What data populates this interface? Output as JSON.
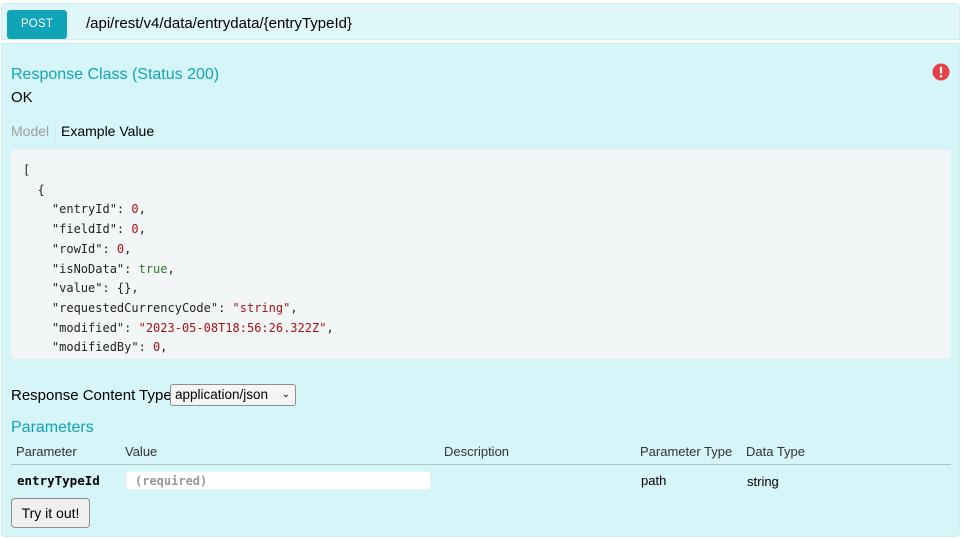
{
  "operation": {
    "method": "POST",
    "path": "/api/rest/v4/data/entrydata/{entryTypeId}"
  },
  "response_class": {
    "title": "Response Class (Status 200)",
    "status_text": "OK",
    "warning_icon": "error-circle-icon",
    "tabs": {
      "model": "Model",
      "example": "Example Value"
    },
    "example_lines": [
      [
        {
          "t": "[",
          "c": "p"
        }
      ],
      [
        {
          "t": "  {",
          "c": "p"
        }
      ],
      [
        {
          "t": "    \"entryId\": ",
          "c": "k"
        },
        {
          "t": "0",
          "c": "n"
        },
        {
          "t": ",",
          "c": "p"
        }
      ],
      [
        {
          "t": "    \"fieldId\": ",
          "c": "k"
        },
        {
          "t": "0",
          "c": "n"
        },
        {
          "t": ",",
          "c": "p"
        }
      ],
      [
        {
          "t": "    \"rowId\": ",
          "c": "k"
        },
        {
          "t": "0",
          "c": "n"
        },
        {
          "t": ",",
          "c": "p"
        }
      ],
      [
        {
          "t": "    \"isNoData\": ",
          "c": "k"
        },
        {
          "t": "true",
          "c": "b"
        },
        {
          "t": ",",
          "c": "p"
        }
      ],
      [
        {
          "t": "    \"value\": {},",
          "c": "k"
        }
      ],
      [
        {
          "t": "    \"requestedCurrencyCode\": ",
          "c": "k"
        },
        {
          "t": "\"string\"",
          "c": "s"
        },
        {
          "t": ",",
          "c": "p"
        }
      ],
      [
        {
          "t": "    \"modified\": ",
          "c": "k"
        },
        {
          "t": "\"2023-05-08T18:56:26.322Z\"",
          "c": "s"
        },
        {
          "t": ",",
          "c": "p"
        }
      ],
      [
        {
          "t": "    \"modifiedBy\": ",
          "c": "k"
        },
        {
          "t": "0",
          "c": "n"
        },
        {
          "t": ",",
          "c": "p"
        }
      ]
    ]
  },
  "response_content_type": {
    "label": "Response Content Type",
    "selected": "application/json"
  },
  "parameters": {
    "title": "Parameters",
    "headers": [
      "Parameter",
      "Value",
      "Description",
      "Parameter Type",
      "Data Type"
    ],
    "rows": [
      {
        "name": "entryTypeId",
        "placeholder": "(required)",
        "description": "",
        "parameter_type": "path",
        "data_type": "string"
      }
    ]
  },
  "try_button_label": "Try it out!",
  "colors": {
    "accent": "#10a4b9",
    "panel": "#d6f5f8",
    "code_bg": "#f3f6f7",
    "warning": "#e5414b"
  }
}
